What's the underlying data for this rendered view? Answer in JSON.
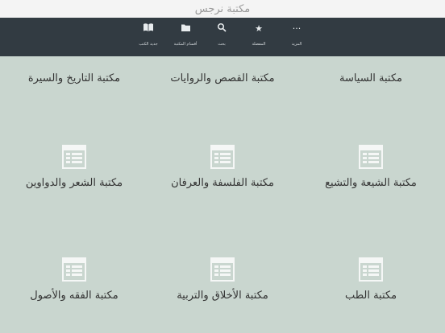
{
  "app": {
    "title": "مكتبة نرجس"
  },
  "tabbar": {
    "tabs": [
      {
        "label": "المزيد",
        "icon": "more-icon"
      },
      {
        "label": "المفضلة",
        "icon": "star-icon"
      },
      {
        "label": "بحث",
        "icon": "search-icon"
      },
      {
        "label": "أقسام المكتبة",
        "icon": "folder-icon"
      },
      {
        "label": "جديد الكتب",
        "icon": "book-icon"
      }
    ]
  },
  "categories": [
    {
      "label": "مكتبة السياسة",
      "icon": "library-icon"
    },
    {
      "label": "مكتبة القصص والروايات",
      "icon": "library-icon"
    },
    {
      "label": "مكتبة التاريخ والسيرة",
      "icon": "library-icon"
    },
    {
      "label": "مكتبة الشيعة والتشيع",
      "icon": "library-icon"
    },
    {
      "label": "مكتبة الفلسفة والعرفان",
      "icon": "library-icon"
    },
    {
      "label": "مكتبة الشعر والدواوين",
      "icon": "library-icon"
    },
    {
      "label": "مكتبة الطب",
      "icon": "library-icon"
    },
    {
      "label": "مكتبة الأخلاق والتربية",
      "icon": "library-icon"
    },
    {
      "label": "مكتبة الفقه والأصول",
      "icon": "library-icon"
    }
  ]
}
